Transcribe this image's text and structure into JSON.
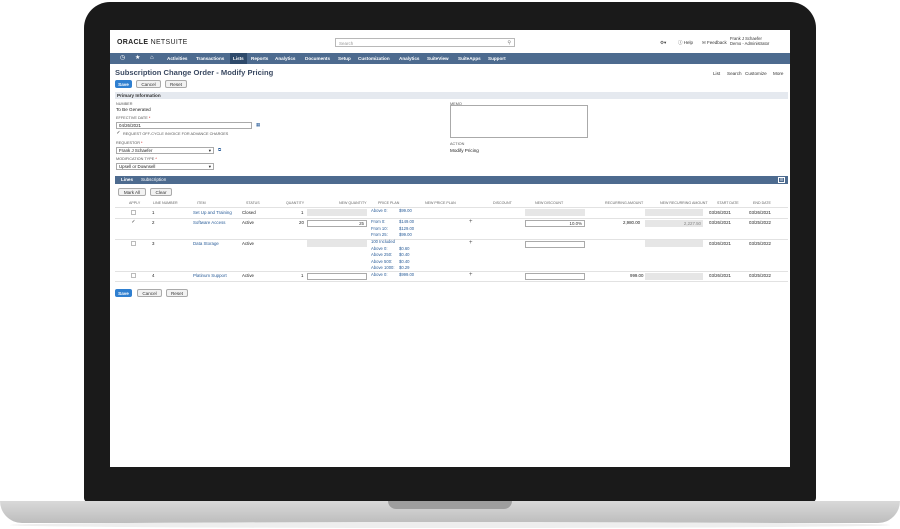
{
  "header": {
    "logo_primary": "ORACLE",
    "logo_secondary": "NETSUITE",
    "search_placeholder": "Search",
    "help": "Help",
    "feedback": "Feedback",
    "user_name": "Frank J Schaefer",
    "user_role": "Demo - Administrator"
  },
  "nav": {
    "items": [
      "Activities",
      "Transactions",
      "Lists",
      "Reports",
      "Analytics",
      "Documents",
      "Setup",
      "Customization",
      "Analytics",
      "SuiteView",
      "SuiteApps",
      "Support"
    ],
    "active": "Lists"
  },
  "page": {
    "title": "Subscription Change Order - Modify Pricing",
    "links": [
      "List",
      "Search",
      "Customize",
      "More"
    ],
    "save": "Save",
    "cancel": "Cancel",
    "reset": "Reset"
  },
  "primary": {
    "section": "Primary Information",
    "number_label": "Number",
    "number_value": "To Be Generated",
    "effective_label": "Effective Date",
    "effective_value": "04/26/2021",
    "request_offcycle": "Request Off-Cycle Invoice for Advance Charges",
    "requestor_label": "Requestor",
    "requestor_value": "Frank J Schaefer",
    "modtype_label": "Modification Type",
    "modtype_value": "Upsell or Downsell",
    "memo_label": "Memo",
    "action_label": "Action",
    "action_value": "Modify Pricing"
  },
  "tabs": [
    "Lines",
    "Subscription"
  ],
  "lines": {
    "mark_all": "Mark All",
    "clear": "Clear",
    "columns": [
      "Apply",
      "Line Number",
      "Item",
      "Status",
      "Quantity",
      "New Quantity",
      "Price Plan",
      "New Price Plan",
      "Discount",
      "New Discount",
      "Recurring Amount",
      "New Recurring Amount",
      "Start Date",
      "End Date"
    ],
    "rows": [
      {
        "line": "1",
        "item": "Set Up and Training",
        "status": "Closed",
        "qty": "1",
        "new_qty": "",
        "plan": [
          [
            "Above 0:",
            "$99.00"
          ]
        ],
        "new_discount": "",
        "recurring": "",
        "new_recurring": "",
        "start": "03/26/2021",
        "end": "03/26/2021",
        "checked": false
      },
      {
        "line": "2",
        "item": "Software Access",
        "status": "Active",
        "qty": "20",
        "new_qty": "25",
        "plan": [
          [
            "From 0:",
            "$149.00"
          ],
          [
            "From 10:",
            "$129.00"
          ],
          [
            "From 25:",
            "$99.00"
          ]
        ],
        "new_discount": "10.0%",
        "recurring": "2,980.00",
        "new_recurring": "2,227.50",
        "start": "03/26/2021",
        "end": "03/25/2022",
        "checked": true
      },
      {
        "line": "3",
        "item": "Data Storage",
        "status": "Active",
        "qty": "",
        "new_qty": "",
        "plan": [
          [
            "100 Included",
            ""
          ],
          [
            "Above 0:",
            "$0.60"
          ],
          [
            "Above 250:",
            "$0.40"
          ],
          [
            "Above 500:",
            "$0.40"
          ],
          [
            "Above 1000:",
            "$0.29"
          ]
        ],
        "new_discount": "",
        "recurring": "",
        "new_recurring": "",
        "start": "03/26/2021",
        "end": "03/25/2022",
        "checked": false
      },
      {
        "line": "4",
        "item": "Platinum Support",
        "status": "Active",
        "qty": "1",
        "new_qty": "",
        "plan": [
          [
            "Above 0:",
            "$999.00"
          ]
        ],
        "new_discount": "",
        "recurring": "999.00",
        "new_recurring": "",
        "start": "03/26/2021",
        "end": "03/25/2022",
        "checked": false
      }
    ]
  }
}
